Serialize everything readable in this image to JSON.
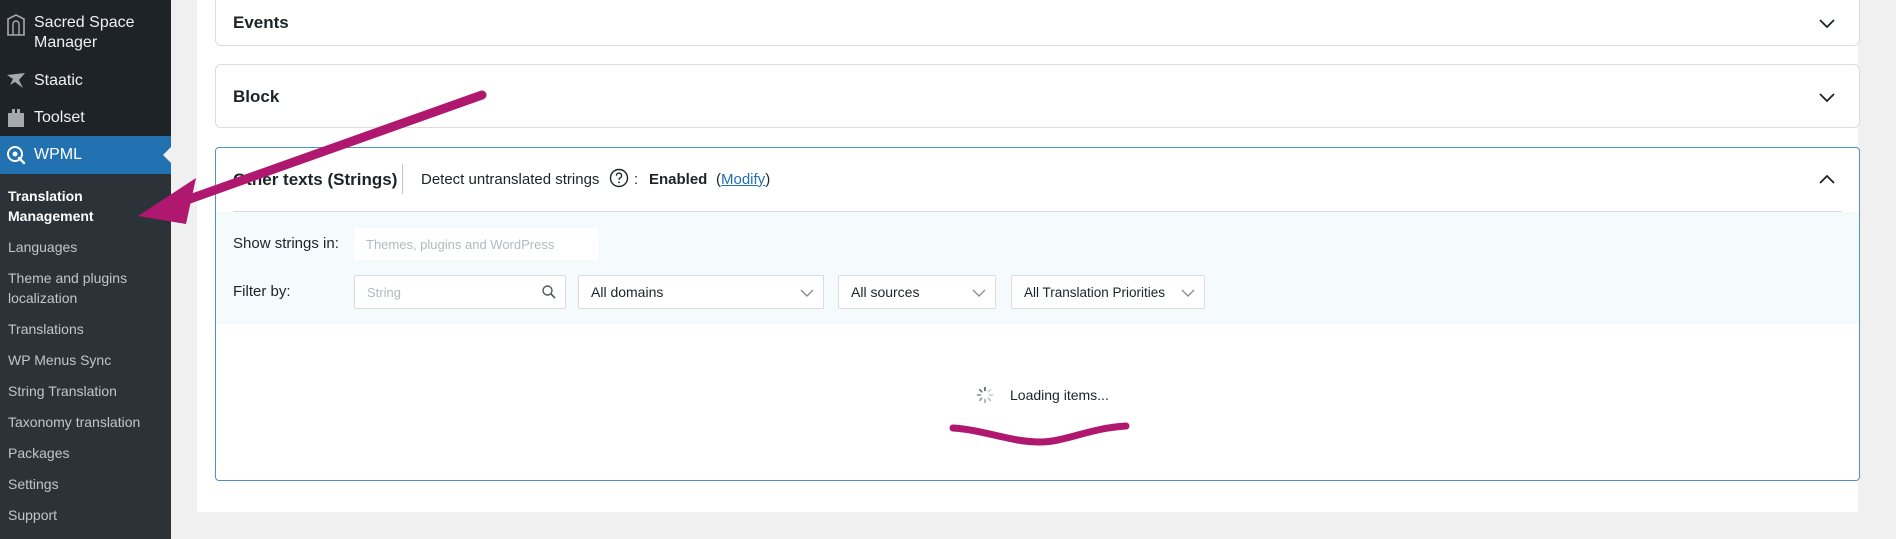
{
  "sidebar": {
    "items": [
      {
        "label": "Sacred Space Manager",
        "icon": "ssm-logo-icon"
      },
      {
        "label": "Staatic",
        "icon": "staatic-icon"
      },
      {
        "label": "Toolset",
        "icon": "toolset-icon"
      },
      {
        "label": "WPML",
        "icon": "wpml-icon"
      }
    ],
    "submenu": [
      "Translation Management",
      "Languages",
      "Theme and plugins localization",
      "Translations",
      "WP Menus Sync",
      "String Translation",
      "Taxonomy translation",
      "Packages",
      "Settings",
      "Support"
    ]
  },
  "panels": {
    "events": {
      "title": "Events"
    },
    "block": {
      "title": "Block"
    },
    "strings": {
      "title": "Other texts (Strings)",
      "detect_label": "Detect untranslated strings",
      "colon": ":",
      "detect_value": "Enabled",
      "modify_open": "(",
      "modify_label": "Modify",
      "modify_close": ")",
      "show_label": "Show strings in:",
      "show_placeholder": "Themes, plugins and WordPress",
      "filter_label": "Filter by:",
      "search_placeholder": "String",
      "domains_selected": "All domains",
      "sources_selected": "All sources",
      "priority_selected": "All Translation Priorities",
      "loading_text": "Loading items..."
    }
  },
  "colors": {
    "sidebar_bg": "#1d2327",
    "submenu_bg": "#2c3338",
    "active_blue": "#2271b1",
    "annotation_magenta": "#b0176e",
    "panel_border_active": "#4f94c0"
  }
}
